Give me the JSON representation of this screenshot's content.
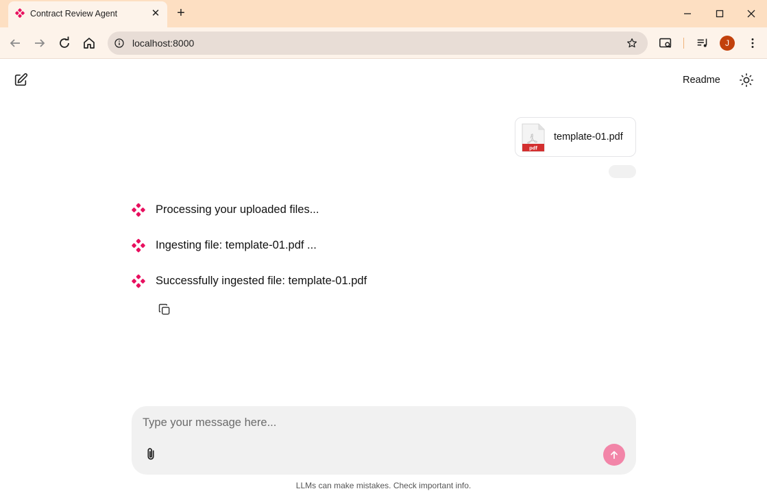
{
  "browser": {
    "tab_title": "Contract Review Agent",
    "tab_close": "✕",
    "new_tab": "+",
    "url": "localhost:8000",
    "profile_initial": "J"
  },
  "app": {
    "readme_label": "Readme",
    "attachment": {
      "file_name": "template-01.pdf",
      "file_type_label": "pdf"
    },
    "messages": [
      "Processing your uploaded files...",
      "Ingesting file: template-01.pdf ...",
      "Successfully ingested file: template-01.pdf"
    ],
    "composer": {
      "placeholder": "Type your message here..."
    },
    "disclaimer": "LLMs can make mistakes. Check important info."
  },
  "colors": {
    "brand": "#e8105f",
    "send_button": "#f285a8",
    "titlebar": "#fddfc2",
    "pdf_red": "#d32f2f"
  },
  "icons": [
    "agent-logo-icon",
    "close-icon",
    "plus-icon",
    "minimize-icon",
    "maximize-icon",
    "back-icon",
    "forward-icon",
    "reload-icon",
    "home-icon",
    "info-icon",
    "star-icon",
    "search-tabs-icon",
    "media-icon",
    "more-icon",
    "edit-icon",
    "sun-icon",
    "pdf-icon",
    "copy-icon",
    "paperclip-icon",
    "arrow-up-icon"
  ]
}
